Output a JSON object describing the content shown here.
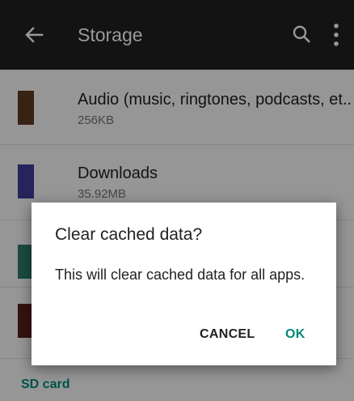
{
  "toolbar": {
    "title": "Storage",
    "back_icon": "arrow-back-icon",
    "search_icon": "search-icon",
    "more_icon": "more-vert-icon"
  },
  "list": {
    "items": [
      {
        "title": "Audio (music, ringtones, podcasts, et..",
        "size": "256KB",
        "color": "#5d3a22"
      },
      {
        "title": "Downloads",
        "size": "35.92MB",
        "color": "#3f3d99"
      },
      {
        "title": "",
        "size": "",
        "color": "#2e7d6b"
      },
      {
        "title": "",
        "size": "",
        "color": "#5a1f1f"
      }
    ],
    "section_label": "SD card"
  },
  "dialog": {
    "title": "Clear cached data?",
    "body": "This will clear cached data for all apps.",
    "cancel_label": "CANCEL",
    "ok_label": "OK"
  },
  "colors": {
    "toolbar_bg": "#212121",
    "accent": "#00897b",
    "scrim": "rgba(0,0,0,0.40)"
  }
}
